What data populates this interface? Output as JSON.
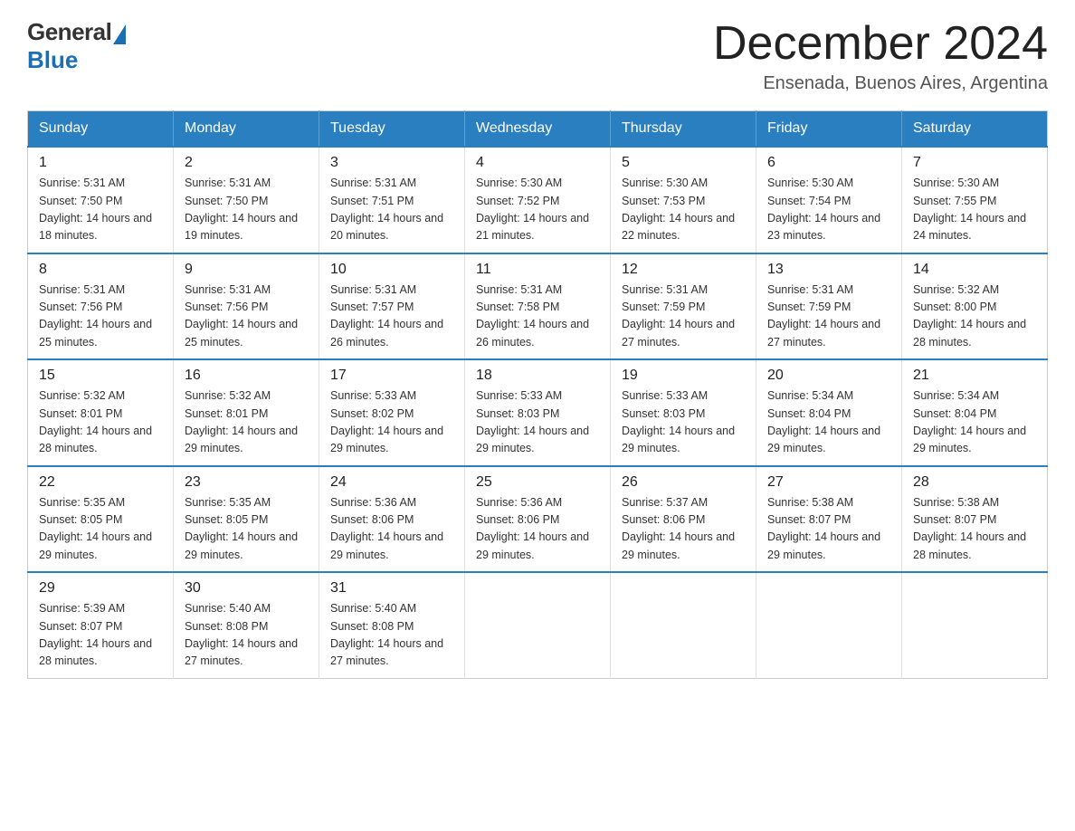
{
  "header": {
    "logo_general": "General",
    "logo_blue": "Blue",
    "month_year": "December 2024",
    "location": "Ensenada, Buenos Aires, Argentina"
  },
  "weekdays": [
    "Sunday",
    "Monday",
    "Tuesday",
    "Wednesday",
    "Thursday",
    "Friday",
    "Saturday"
  ],
  "weeks": [
    [
      {
        "day": "1",
        "sunrise": "5:31 AM",
        "sunset": "7:50 PM",
        "daylight": "14 hours and 18 minutes."
      },
      {
        "day": "2",
        "sunrise": "5:31 AM",
        "sunset": "7:50 PM",
        "daylight": "14 hours and 19 minutes."
      },
      {
        "day": "3",
        "sunrise": "5:31 AM",
        "sunset": "7:51 PM",
        "daylight": "14 hours and 20 minutes."
      },
      {
        "day": "4",
        "sunrise": "5:30 AM",
        "sunset": "7:52 PM",
        "daylight": "14 hours and 21 minutes."
      },
      {
        "day": "5",
        "sunrise": "5:30 AM",
        "sunset": "7:53 PM",
        "daylight": "14 hours and 22 minutes."
      },
      {
        "day": "6",
        "sunrise": "5:30 AM",
        "sunset": "7:54 PM",
        "daylight": "14 hours and 23 minutes."
      },
      {
        "day": "7",
        "sunrise": "5:30 AM",
        "sunset": "7:55 PM",
        "daylight": "14 hours and 24 minutes."
      }
    ],
    [
      {
        "day": "8",
        "sunrise": "5:31 AM",
        "sunset": "7:56 PM",
        "daylight": "14 hours and 25 minutes."
      },
      {
        "day": "9",
        "sunrise": "5:31 AM",
        "sunset": "7:56 PM",
        "daylight": "14 hours and 25 minutes."
      },
      {
        "day": "10",
        "sunrise": "5:31 AM",
        "sunset": "7:57 PM",
        "daylight": "14 hours and 26 minutes."
      },
      {
        "day": "11",
        "sunrise": "5:31 AM",
        "sunset": "7:58 PM",
        "daylight": "14 hours and 26 minutes."
      },
      {
        "day": "12",
        "sunrise": "5:31 AM",
        "sunset": "7:59 PM",
        "daylight": "14 hours and 27 minutes."
      },
      {
        "day": "13",
        "sunrise": "5:31 AM",
        "sunset": "7:59 PM",
        "daylight": "14 hours and 27 minutes."
      },
      {
        "day": "14",
        "sunrise": "5:32 AM",
        "sunset": "8:00 PM",
        "daylight": "14 hours and 28 minutes."
      }
    ],
    [
      {
        "day": "15",
        "sunrise": "5:32 AM",
        "sunset": "8:01 PM",
        "daylight": "14 hours and 28 minutes."
      },
      {
        "day": "16",
        "sunrise": "5:32 AM",
        "sunset": "8:01 PM",
        "daylight": "14 hours and 29 minutes."
      },
      {
        "day": "17",
        "sunrise": "5:33 AM",
        "sunset": "8:02 PM",
        "daylight": "14 hours and 29 minutes."
      },
      {
        "day": "18",
        "sunrise": "5:33 AM",
        "sunset": "8:03 PM",
        "daylight": "14 hours and 29 minutes."
      },
      {
        "day": "19",
        "sunrise": "5:33 AM",
        "sunset": "8:03 PM",
        "daylight": "14 hours and 29 minutes."
      },
      {
        "day": "20",
        "sunrise": "5:34 AM",
        "sunset": "8:04 PM",
        "daylight": "14 hours and 29 minutes."
      },
      {
        "day": "21",
        "sunrise": "5:34 AM",
        "sunset": "8:04 PM",
        "daylight": "14 hours and 29 minutes."
      }
    ],
    [
      {
        "day": "22",
        "sunrise": "5:35 AM",
        "sunset": "8:05 PM",
        "daylight": "14 hours and 29 minutes."
      },
      {
        "day": "23",
        "sunrise": "5:35 AM",
        "sunset": "8:05 PM",
        "daylight": "14 hours and 29 minutes."
      },
      {
        "day": "24",
        "sunrise": "5:36 AM",
        "sunset": "8:06 PM",
        "daylight": "14 hours and 29 minutes."
      },
      {
        "day": "25",
        "sunrise": "5:36 AM",
        "sunset": "8:06 PM",
        "daylight": "14 hours and 29 minutes."
      },
      {
        "day": "26",
        "sunrise": "5:37 AM",
        "sunset": "8:06 PM",
        "daylight": "14 hours and 29 minutes."
      },
      {
        "day": "27",
        "sunrise": "5:38 AM",
        "sunset": "8:07 PM",
        "daylight": "14 hours and 29 minutes."
      },
      {
        "day": "28",
        "sunrise": "5:38 AM",
        "sunset": "8:07 PM",
        "daylight": "14 hours and 28 minutes."
      }
    ],
    [
      {
        "day": "29",
        "sunrise": "5:39 AM",
        "sunset": "8:07 PM",
        "daylight": "14 hours and 28 minutes."
      },
      {
        "day": "30",
        "sunrise": "5:40 AM",
        "sunset": "8:08 PM",
        "daylight": "14 hours and 27 minutes."
      },
      {
        "day": "31",
        "sunrise": "5:40 AM",
        "sunset": "8:08 PM",
        "daylight": "14 hours and 27 minutes."
      },
      null,
      null,
      null,
      null
    ]
  ]
}
